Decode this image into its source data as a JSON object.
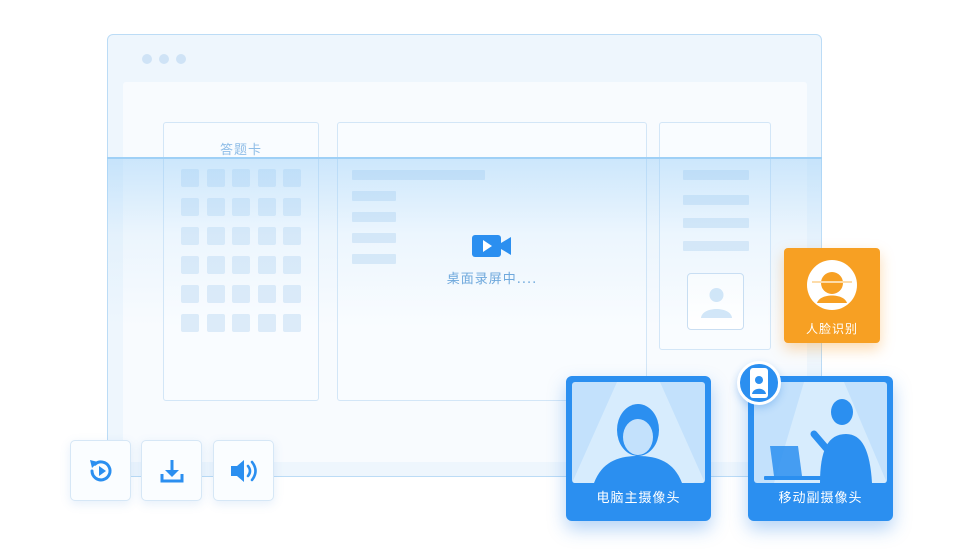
{
  "window": {
    "answer_card_title": "答题卡",
    "recording_status": "桌面录屏中...."
  },
  "toolbar": {
    "buttons": [
      {
        "icon": "replay-icon"
      },
      {
        "icon": "download-icon"
      },
      {
        "icon": "speaker-icon"
      }
    ]
  },
  "features": {
    "face_recognition_label": "人脸识别",
    "pc_camera_label": "电脑主摄像头",
    "mobile_camera_label": "移动副摄像头"
  },
  "colors": {
    "primary_blue": "#2b8ff0",
    "face_orange": "#f7a023",
    "window_border": "#bcdcf6"
  }
}
